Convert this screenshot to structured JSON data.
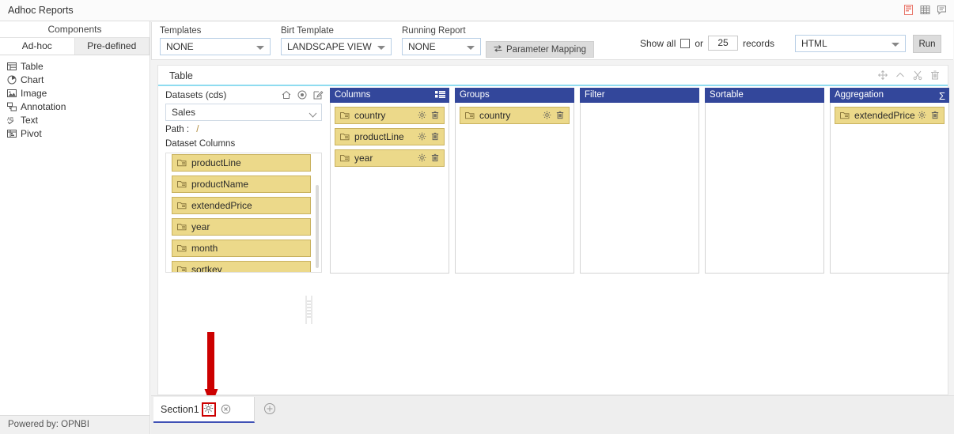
{
  "window": {
    "title": "Adhoc Reports",
    "tools": [
      {
        "name": "pdf-export-icon",
        "label": "PDF"
      },
      {
        "name": "grid-view-icon",
        "label": "Grid"
      },
      {
        "name": "comment-icon",
        "label": "Comment"
      }
    ]
  },
  "sidebar": {
    "header": "Components",
    "tabs": [
      {
        "label": "Ad-hoc",
        "active": true
      },
      {
        "label": "Pre-defined",
        "active": false
      }
    ],
    "items": [
      {
        "label": "Table",
        "icon": "table-icon"
      },
      {
        "label": "Chart",
        "icon": "chart-icon"
      },
      {
        "label": "Image",
        "icon": "image-icon"
      },
      {
        "label": "Annotation",
        "icon": "annotation-icon"
      },
      {
        "label": "Text",
        "icon": "text-icon"
      },
      {
        "label": "Pivot",
        "icon": "pivot-icon"
      }
    ],
    "footer": "Powered by: OPNBI"
  },
  "toolbar": {
    "templates": {
      "label": "Templates",
      "value": "NONE"
    },
    "birt_template": {
      "label": "Birt Template",
      "value": "LANDSCAPE VIEW"
    },
    "running_report": {
      "label": "Running Report",
      "value": "NONE"
    },
    "parameter_mapping": "Parameter Mapping",
    "show_all_label": "Show all",
    "or_label": "or",
    "records_value": "25",
    "records_label": "records",
    "format": "HTML",
    "run_label": "Run"
  },
  "card": {
    "title": "Table",
    "actions": [
      {
        "name": "move-icon"
      },
      {
        "name": "chevron-up-icon"
      },
      {
        "name": "cut-icon"
      },
      {
        "name": "delete-icon"
      }
    ]
  },
  "datasets": {
    "title": "Datasets (cds)",
    "actions": [
      {
        "name": "home-icon"
      },
      {
        "name": "target-icon"
      },
      {
        "name": "edit-icon"
      }
    ],
    "selected": "Sales",
    "path_label": "Path :",
    "path_value": "/",
    "columns_label": "Dataset Columns",
    "columns": [
      "productLine",
      "productName",
      "extendedPrice",
      "year",
      "month",
      "sortkey"
    ]
  },
  "buckets": [
    {
      "name": "columns",
      "title": "Columns",
      "header_icon": "list-settings-icon",
      "items": [
        "country",
        "productLine",
        "year"
      ]
    },
    {
      "name": "groups",
      "title": "Groups",
      "header_icon": "",
      "items": [
        "country"
      ]
    },
    {
      "name": "filter",
      "title": "Filter",
      "header_icon": "",
      "items": []
    },
    {
      "name": "sortable",
      "title": "Sortable",
      "header_icon": "",
      "items": []
    },
    {
      "name": "aggregation",
      "title": "Aggregation",
      "header_icon": "sigma-icon",
      "items": [
        "extendedPrice"
      ]
    }
  ],
  "section_bar": {
    "tab_label": "Section1",
    "settings_icon": "gear-icon",
    "close_icon": "close-circle-icon",
    "add_icon": "add-section-icon"
  },
  "colors": {
    "bucket_header": "#33479b",
    "pill_bg": "#ecd98a",
    "pill_border": "#c9b25f",
    "card_accent": "#8fdcf0",
    "annotation": "#cc0000",
    "active_tab_underline": "#3f51b5"
  }
}
